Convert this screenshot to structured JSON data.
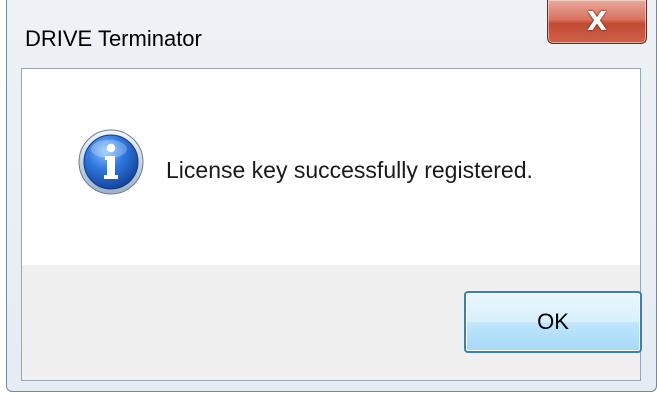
{
  "dialog": {
    "title": "DRIVE Terminator",
    "close_glyph": "X",
    "icon": "info-icon",
    "message": "License key successfully registered.",
    "ok_label": "OK"
  },
  "colors": {
    "close_button": "#c8503a",
    "ok_border": "#3c7fb1",
    "icon_blue": "#1f5fbf",
    "content_bg": "#ffffff",
    "footer_bg": "#f0f0f0"
  }
}
